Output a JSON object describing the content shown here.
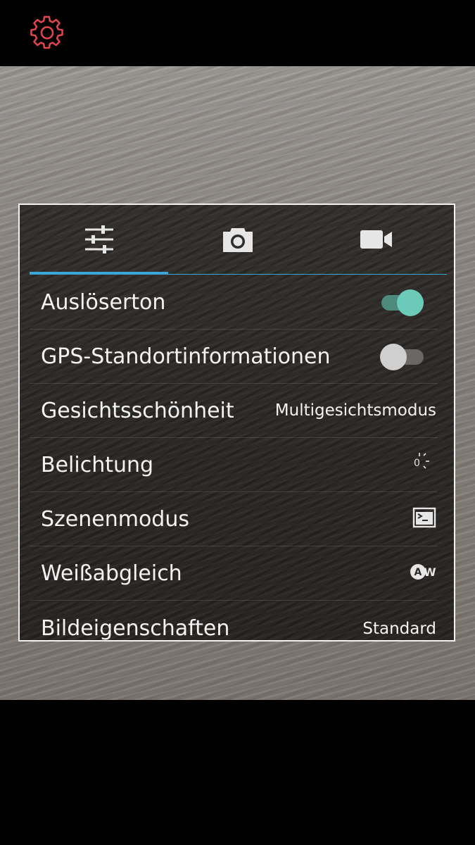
{
  "colors": {
    "accent_blue": "#3aa7d8",
    "toggle_on": "#6ccab9",
    "gear_red": "#e0454a"
  },
  "top_bar": {
    "settings_icon": "gear-icon"
  },
  "tabs": [
    {
      "icon": "sliders-icon",
      "selected": true
    },
    {
      "icon": "camera-icon",
      "selected": false
    },
    {
      "icon": "video-camera-icon",
      "selected": false
    }
  ],
  "settings": {
    "shutter_sound": {
      "label": "Auslöserton",
      "enabled": true
    },
    "gps": {
      "label": "GPS-Standortinformationen",
      "enabled": false
    },
    "face_beauty": {
      "label": "Gesichtsschönheit",
      "value": "Multigesichtsmodus"
    },
    "exposure": {
      "label": "Belichtung",
      "value": "0",
      "icon": "exposure-icon"
    },
    "scene_mode": {
      "label": "Szenenmodus",
      "icon": "scene-mode-icon"
    },
    "white_balance": {
      "label": "Weißabgleich",
      "icon": "auto-white-balance-icon"
    },
    "image_properties": {
      "label": "Bildeigenschaften",
      "value": "Standard"
    }
  }
}
